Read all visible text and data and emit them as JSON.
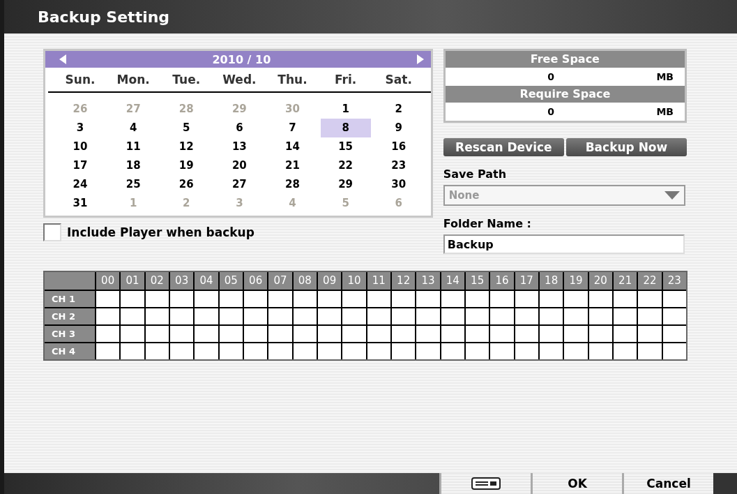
{
  "window": {
    "title": "Backup Setting"
  },
  "calendar": {
    "month_label": "2010 / 10",
    "weekdays": [
      "Sun.",
      "Mon.",
      "Tue.",
      "Wed.",
      "Thu.",
      "Fri.",
      "Sat."
    ],
    "days": [
      {
        "label": "26",
        "muted": true,
        "selected": false
      },
      {
        "label": "27",
        "muted": true,
        "selected": false
      },
      {
        "label": "28",
        "muted": true,
        "selected": false
      },
      {
        "label": "29",
        "muted": true,
        "selected": false
      },
      {
        "label": "30",
        "muted": true,
        "selected": false
      },
      {
        "label": "1",
        "muted": false,
        "selected": false
      },
      {
        "label": "2",
        "muted": false,
        "selected": false
      },
      {
        "label": "3",
        "muted": false,
        "selected": false
      },
      {
        "label": "4",
        "muted": false,
        "selected": false
      },
      {
        "label": "5",
        "muted": false,
        "selected": false
      },
      {
        "label": "6",
        "muted": false,
        "selected": false
      },
      {
        "label": "7",
        "muted": false,
        "selected": false
      },
      {
        "label": "8",
        "muted": false,
        "selected": true
      },
      {
        "label": "9",
        "muted": false,
        "selected": false
      },
      {
        "label": "10",
        "muted": false,
        "selected": false
      },
      {
        "label": "11",
        "muted": false,
        "selected": false
      },
      {
        "label": "12",
        "muted": false,
        "selected": false
      },
      {
        "label": "13",
        "muted": false,
        "selected": false
      },
      {
        "label": "14",
        "muted": false,
        "selected": false
      },
      {
        "label": "15",
        "muted": false,
        "selected": false
      },
      {
        "label": "16",
        "muted": false,
        "selected": false
      },
      {
        "label": "17",
        "muted": false,
        "selected": false
      },
      {
        "label": "18",
        "muted": false,
        "selected": false
      },
      {
        "label": "19",
        "muted": false,
        "selected": false
      },
      {
        "label": "20",
        "muted": false,
        "selected": false
      },
      {
        "label": "21",
        "muted": false,
        "selected": false
      },
      {
        "label": "22",
        "muted": false,
        "selected": false
      },
      {
        "label": "23",
        "muted": false,
        "selected": false
      },
      {
        "label": "24",
        "muted": false,
        "selected": false
      },
      {
        "label": "25",
        "muted": false,
        "selected": false
      },
      {
        "label": "26",
        "muted": false,
        "selected": false
      },
      {
        "label": "27",
        "muted": false,
        "selected": false
      },
      {
        "label": "28",
        "muted": false,
        "selected": false
      },
      {
        "label": "29",
        "muted": false,
        "selected": false
      },
      {
        "label": "30",
        "muted": false,
        "selected": false
      },
      {
        "label": "31",
        "muted": false,
        "selected": false
      },
      {
        "label": "1",
        "muted": true,
        "selected": false
      },
      {
        "label": "2",
        "muted": true,
        "selected": false
      },
      {
        "label": "3",
        "muted": true,
        "selected": false
      },
      {
        "label": "4",
        "muted": true,
        "selected": false
      },
      {
        "label": "5",
        "muted": true,
        "selected": false
      },
      {
        "label": "6",
        "muted": true,
        "selected": false
      }
    ]
  },
  "include_player": {
    "label": "Include Player when backup",
    "checked": false
  },
  "space": [
    {
      "title": "Free Space",
      "value": "0",
      "unit": "MB"
    },
    {
      "title": "Require Space",
      "value": "0",
      "unit": "MB"
    }
  ],
  "actions": [
    "Rescan Device",
    "Backup Now"
  ],
  "save_path": {
    "label": "Save Path",
    "value": "None",
    "disabled": true
  },
  "folder_name": {
    "label": "Folder Name :",
    "value": "Backup"
  },
  "schedule": {
    "hours": [
      "00",
      "01",
      "02",
      "03",
      "04",
      "05",
      "06",
      "07",
      "08",
      "09",
      "10",
      "11",
      "12",
      "13",
      "14",
      "15",
      "16",
      "17",
      "18",
      "19",
      "20",
      "21",
      "22",
      "23"
    ],
    "channels": [
      "CH 1",
      "CH 2",
      "CH 3",
      "CH 4"
    ]
  },
  "footer": {
    "buttons": [
      "OK",
      "Cancel"
    ]
  }
}
